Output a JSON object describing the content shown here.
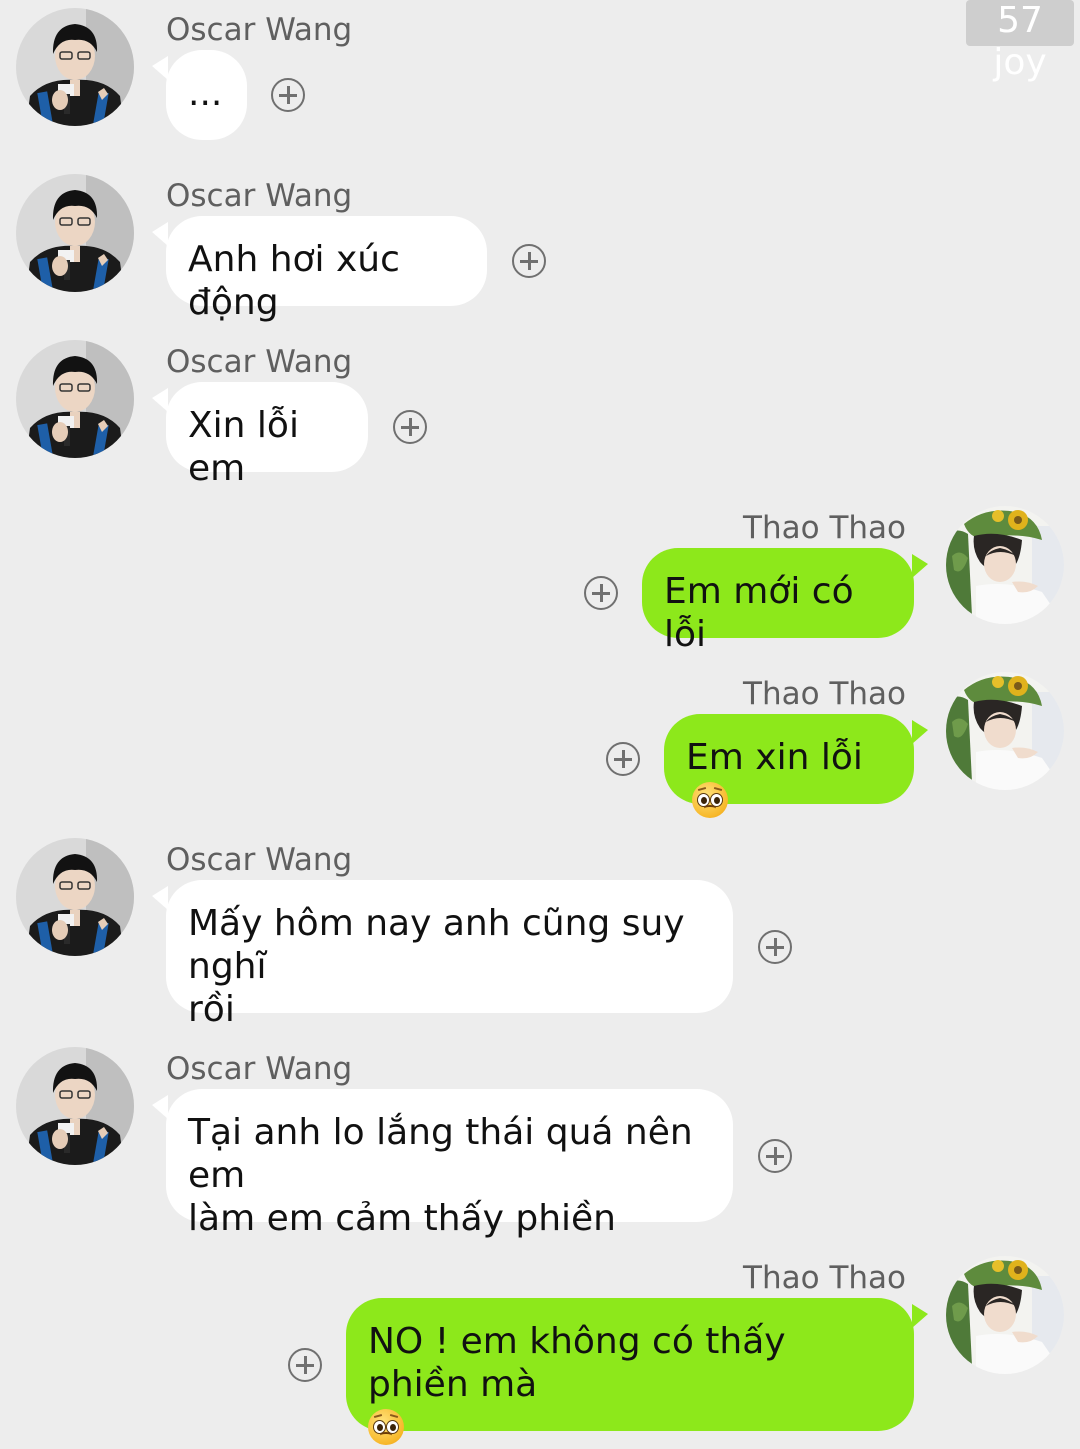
{
  "watermark": "57 joy",
  "participants": {
    "other": "Oscar Wang",
    "me": "Thao Thao"
  },
  "messages": [
    {
      "sender": "Oscar Wang",
      "text": "..."
    },
    {
      "sender": "Oscar Wang",
      "text": "Anh hơi xúc động"
    },
    {
      "sender": "Oscar Wang",
      "text": "Xin lỗi em"
    },
    {
      "sender": "Thao Thao",
      "text": "Em mới có lỗi"
    },
    {
      "sender": "Thao Thao",
      "text": "Em xin lỗi",
      "emoji": "pleading-face"
    },
    {
      "sender": "Oscar Wang",
      "line1": "Mấy hôm nay anh cũng suy nghĩ",
      "line2": "rồi"
    },
    {
      "sender": "Oscar Wang",
      "line1": "Tại anh lo lắng thái quá nên em",
      "line2": "làm em cảm thấy phiền"
    },
    {
      "sender": "Thao Thao",
      "text": "NO ! em không có thấy phiền mà",
      "emoji": "pleading-face"
    }
  ],
  "colors": {
    "background": "#ededed",
    "incoming_bubble": "#ffffff",
    "outgoing_bubble": "#8de81b"
  },
  "icons": {
    "reaction_button": "add-circle-icon",
    "emoji": "pleading-face"
  }
}
